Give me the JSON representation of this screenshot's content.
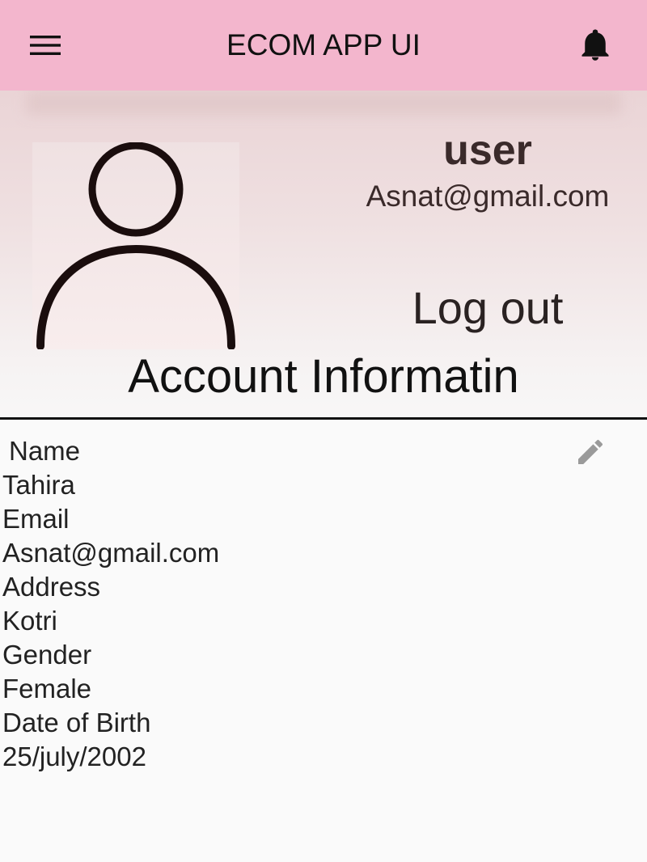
{
  "appbar": {
    "title": "ECOM APP UI",
    "menu_icon": "hamburger-menu-icon",
    "notification_icon": "bell-icon",
    "color": "#f3b6cd"
  },
  "profile": {
    "avatar_icon": "person-outline-icon",
    "username": "user",
    "email": "Asnat@gmail.com",
    "logout_label": "Log out"
  },
  "account": {
    "title": "Account Informatin",
    "edit_icon": "pencil-edit-icon",
    "fields": [
      {
        "label": "Name",
        "value": "Tahira"
      },
      {
        "label": "Email",
        "value": "Asnat@gmail.com"
      },
      {
        "label": "Address",
        "value": "Kotri"
      },
      {
        "label": "Gender",
        "value": "Female"
      },
      {
        "label": "Date of Birth",
        "value": "25/july/2002"
      }
    ]
  }
}
